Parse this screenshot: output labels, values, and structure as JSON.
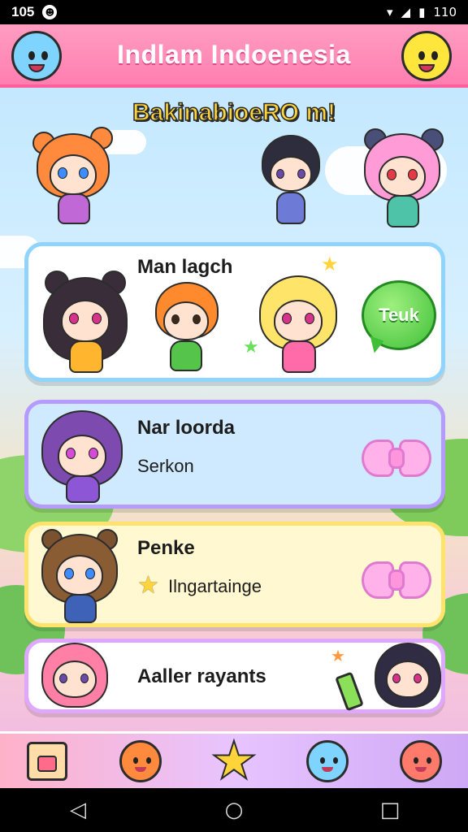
{
  "status_bar": {
    "time": "105",
    "notification_icon": "game-icon",
    "battery": "110"
  },
  "header": {
    "title": "Indlam Indoenesia"
  },
  "banner": {
    "title": "BakinabioeRO m!"
  },
  "cards": [
    {
      "label": "Man lagch",
      "button_label": "Teuk"
    },
    {
      "label": "Nar loorda",
      "sub": "Serkon"
    },
    {
      "label": "Penke",
      "sub": "Ilngartainge"
    },
    {
      "label": "Aaller rayants"
    }
  ],
  "bottom_nav": [
    "shop-icon",
    "orange-blob-icon",
    "star-icon",
    "blue-blob-icon",
    "red-blob-icon"
  ],
  "colors": {
    "header": "#ff7fb0",
    "card1_border": "#8fd3ff",
    "card2_border": "#b69bff",
    "card3_border": "#ffe36d",
    "card4_border": "#e0a7ff",
    "talk_button": "#3fbf38"
  }
}
